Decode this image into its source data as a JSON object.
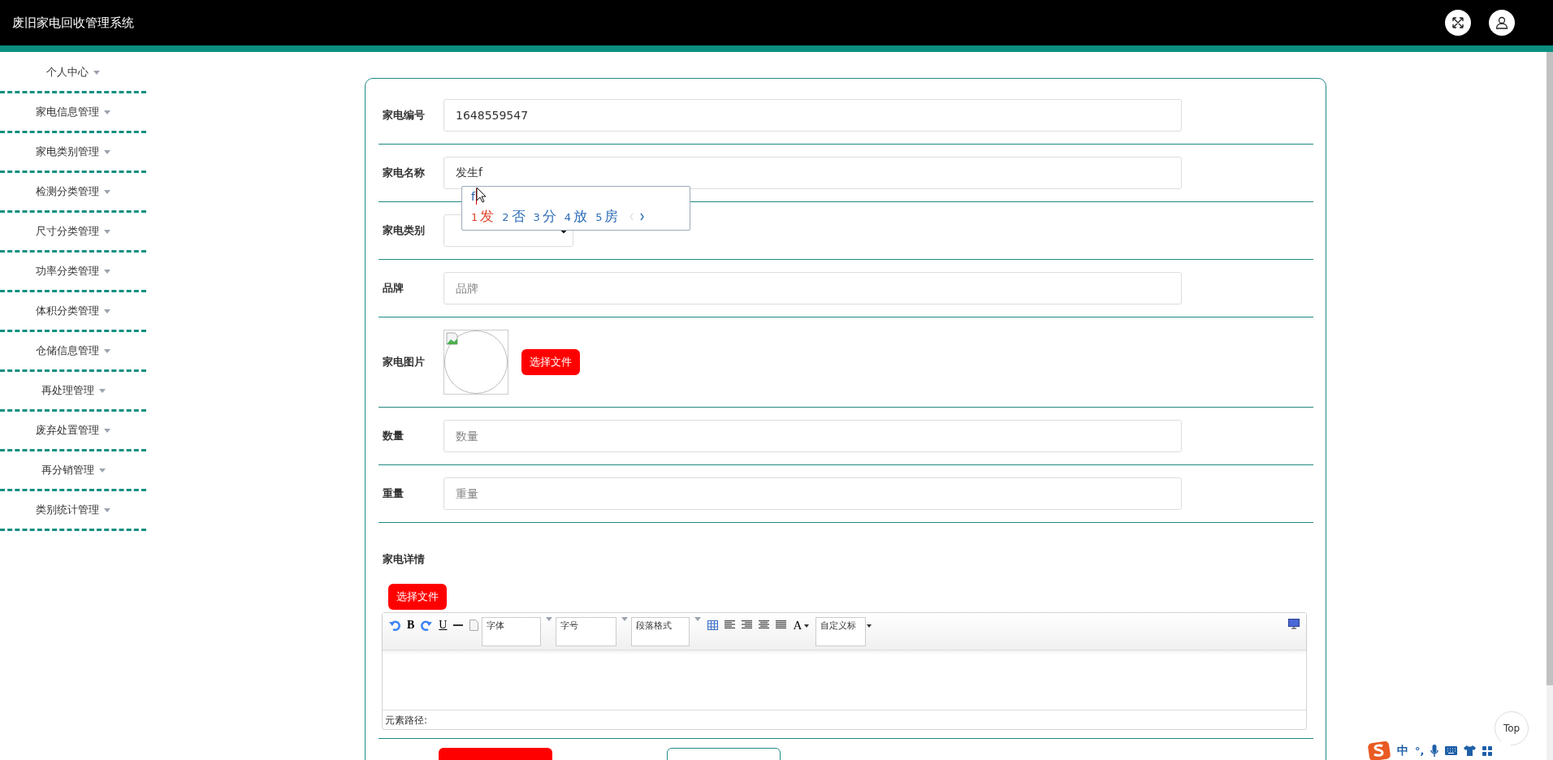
{
  "header": {
    "title": "废旧家电回收管理系统"
  },
  "sidebar": {
    "items": [
      {
        "label": "个人中心"
      },
      {
        "label": "家电信息管理"
      },
      {
        "label": "家电类别管理"
      },
      {
        "label": "检测分类管理"
      },
      {
        "label": "尺寸分类管理"
      },
      {
        "label": "功率分类管理"
      },
      {
        "label": "体积分类管理"
      },
      {
        "label": "仓储信息管理"
      },
      {
        "label": "再处理管理"
      },
      {
        "label": "废弃处置管理"
      },
      {
        "label": "再分销管理"
      },
      {
        "label": "类别统计管理"
      }
    ]
  },
  "form": {
    "fields": [
      {
        "kind": "text",
        "label": "家电编号",
        "value": "1648559547"
      },
      {
        "kind": "text",
        "label": "家电名称",
        "value": "发生f"
      },
      {
        "kind": "select",
        "label": "家电类别"
      },
      {
        "kind": "text",
        "label": "品牌",
        "placeholder": "品牌"
      },
      {
        "kind": "image",
        "label": "家电图片",
        "button": "选择文件"
      },
      {
        "kind": "text",
        "label": "数量",
        "placeholder": "数量"
      },
      {
        "kind": "text",
        "label": "重量",
        "placeholder": "重量"
      },
      {
        "kind": "editor",
        "label": "家电详情",
        "button": "选择文件",
        "toolbar": {
          "bold": "B",
          "underline": "U",
          "font": "字体",
          "size": "字号",
          "paragraph": "段落格式",
          "font_color": "A",
          "custom": "自定义标"
        },
        "path_label": "元素路径:"
      }
    ]
  },
  "ime_popup": {
    "composition": "f",
    "candidates": [
      {
        "index": "1",
        "text": "发",
        "selected": true
      },
      {
        "index": "2",
        "text": "否",
        "selected": false
      },
      {
        "index": "3",
        "text": "分",
        "selected": false
      },
      {
        "index": "4",
        "text": "放",
        "selected": false
      },
      {
        "index": "5",
        "text": "房",
        "selected": false
      }
    ]
  },
  "ime_toolbar": {
    "mode": "中",
    "punctuation": "°,"
  },
  "top_button": "Top"
}
